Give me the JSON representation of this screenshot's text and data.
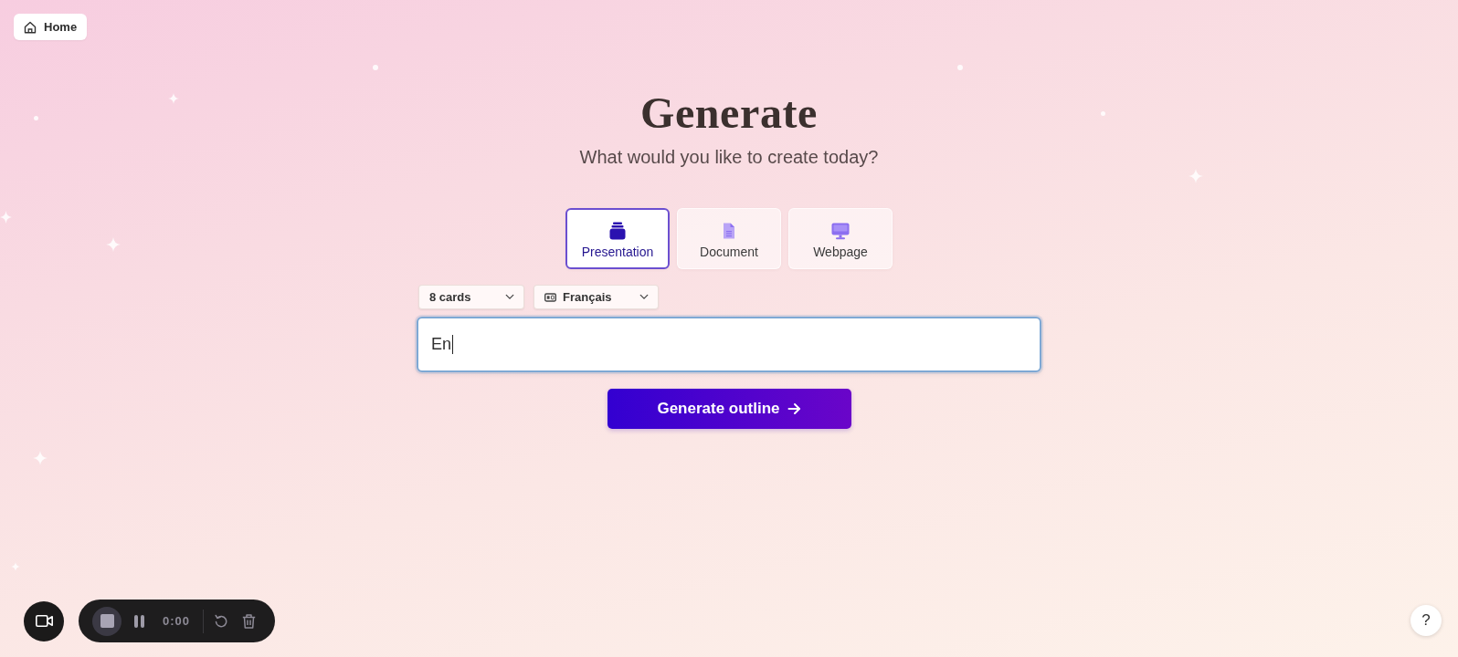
{
  "home_button": {
    "label": "Home"
  },
  "heading": {
    "title": "Generate",
    "subtitle": "What would you like to create today?"
  },
  "types": [
    {
      "label": "Presentation",
      "kind": "presentation",
      "selected": true
    },
    {
      "label": "Document",
      "kind": "document",
      "selected": false
    },
    {
      "label": "Webpage",
      "kind": "webpage",
      "selected": false
    }
  ],
  "options": [
    {
      "kind": "count",
      "value": "8 cards"
    },
    {
      "kind": "language",
      "value": "Français"
    }
  ],
  "prompt": {
    "value": "En",
    "focused": true
  },
  "generate_button": {
    "label": "Generate outline"
  },
  "recorder": {
    "time": "0:00"
  },
  "help_button": {
    "label": "?"
  }
}
